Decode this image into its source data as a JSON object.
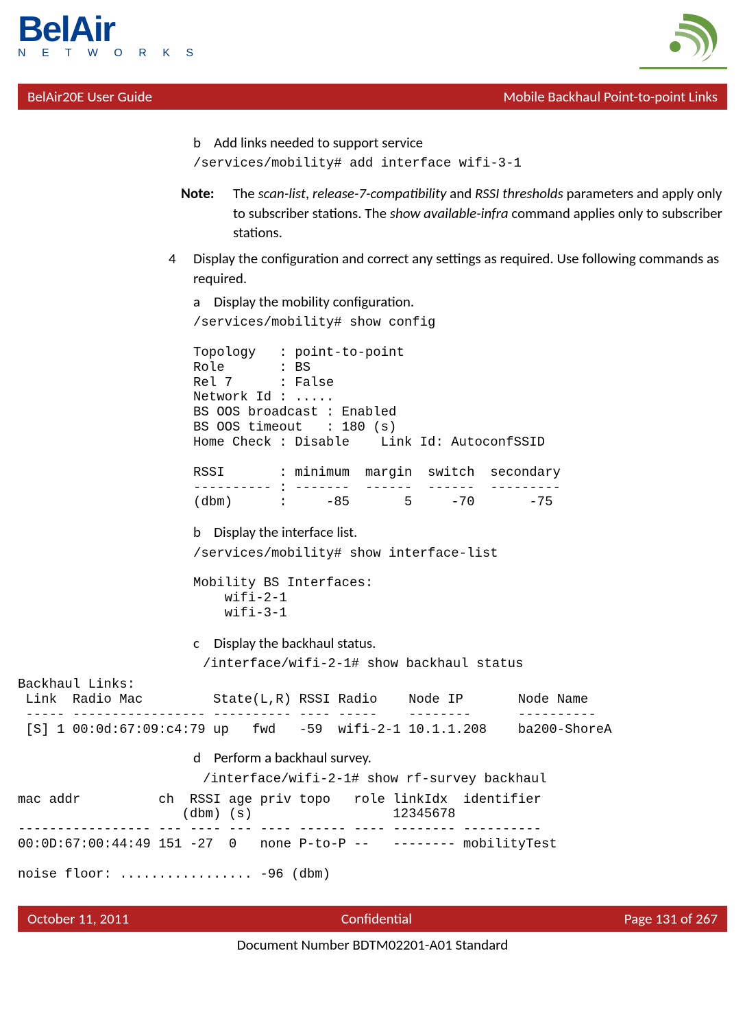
{
  "logo": {
    "main": "BelAir",
    "sub": "N E T W O R K S"
  },
  "banner": {
    "left": "BelAir20E User Guide",
    "right": "Mobile Backhaul Point-to-point Links"
  },
  "step_b": {
    "marker": "b",
    "text": "Add links needed to support service"
  },
  "cmd_b": "/services/mobility# add interface wifi-3-1",
  "note": {
    "label": "Note:",
    "part1": "The ",
    "i1": "scan-list",
    "comma": ", ",
    "i2": "release-7-compatibility",
    "and": " and ",
    "i3": "RSSI thresholds",
    "part2": " parameters and apply only to subscriber stations. The ",
    "i4": "show available-infra",
    "part3": " command applies only to subscriber stations."
  },
  "step4": {
    "marker": "4",
    "text": "Display the configuration and correct any settings as required. Use following commands as required."
  },
  "step4a": {
    "marker": "a",
    "text": "Display the mobility configuration."
  },
  "block4a": "/services/mobility# show config\n\nTopology   : point-to-point\nRole       : BS\nRel 7      : False\nNetwork Id : .....\nBS OOS broadcast : Enabled\nBS OOS timeout   : 180 (s)\nHome Check : Disable    Link Id: AutoconfSSID\n\nRSSI       : minimum  margin  switch  secondary\n---------- : -------  ------  ------  ---------\n(dbm)      :     -85       5     -70       -75",
  "step4b": {
    "marker": "b",
    "text": "Display the interface list."
  },
  "block4b": "/services/mobility# show interface-list\n\nMobility BS Interfaces:\n    wifi-2-1\n    wifi-3-1",
  "step4c": {
    "marker": "c",
    "text": "Display the backhaul status."
  },
  "cmd4c": "/interface/wifi-2-1# show backhaul status",
  "block4c_wide": "Backhaul Links:\n Link  Radio Mac         State(L,R) RSSI Radio    Node IP       Node Name\n ----- ----------------- ---------- ---- -----    --------      ----------\n [S] 1 00:0d:67:09:c4:79 up   fwd   -59  wifi-2-1 10.1.1.208    ba200-ShoreA",
  "step4d": {
    "marker": "d",
    "text": "Perform a backhaul survey."
  },
  "cmd4d": "/interface/wifi-2-1# show rf-survey backhaul",
  "block4d_wide": "mac addr          ch  RSSI age priv topo   role linkIdx  identifier\n                     (dbm) (s)                  12345678\n----------------- --- ---- --- ---- ------ ---- -------- ----------\n00:0D:67:00:44:49 151 -27  0   none P-to-P --   -------- mobilityTest\n\nnoise floor: ................. -96 (dbm)",
  "footer": {
    "left": "October 11, 2011",
    "center": "Confidential",
    "right": "Page 131 of 267"
  },
  "docnum": "Document Number BDTM02201-A01 Standard"
}
